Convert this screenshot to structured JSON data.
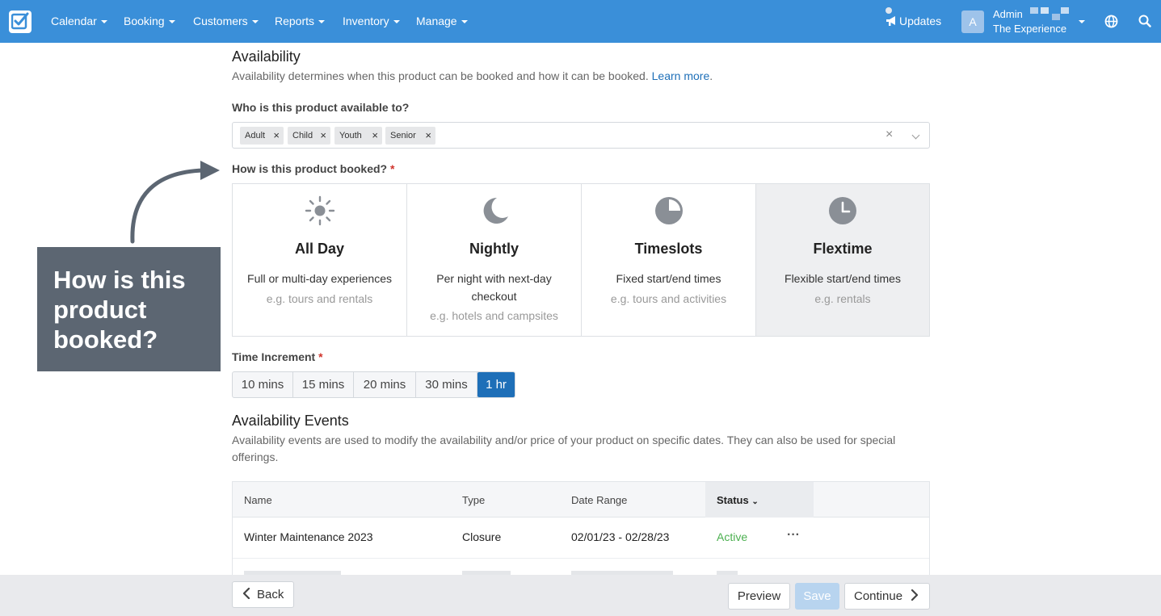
{
  "nav": {
    "items": [
      "Calendar",
      "Booking",
      "Customers",
      "Reports",
      "Inventory",
      "Manage"
    ],
    "updates": "Updates",
    "avatar_letter": "A",
    "admin_name": "Admin",
    "company": "The Experience"
  },
  "availability": {
    "title": "Availability",
    "description": "Availability determines when this product can be booked and how it can be booked.",
    "learn_more": "Learn more",
    "learn_more_suffix": "."
  },
  "who": {
    "label": "Who is this product available to?",
    "tags": [
      "Adult",
      "Child",
      "Youth",
      "Senior"
    ]
  },
  "how": {
    "label": "How is this product booked?",
    "required_mark": "*",
    "options": [
      {
        "title": "All Day",
        "desc": "Full or multi-day experiences",
        "example": "e.g. tours and rentals",
        "icon": "sun-icon",
        "selected": false
      },
      {
        "title": "Nightly",
        "desc": "Per night with next-day checkout",
        "example": "e.g. hotels and campsites",
        "icon": "moon-icon",
        "selected": false
      },
      {
        "title": "Timeslots",
        "desc": "Fixed start/end times",
        "example": "e.g. tours and activities",
        "icon": "pie-clock-icon",
        "selected": false
      },
      {
        "title": "Flextime",
        "desc": "Flexible start/end times",
        "example": "e.g. rentals",
        "icon": "clock-icon",
        "selected": true
      }
    ]
  },
  "callout": {
    "text": "How is this product booked?"
  },
  "increment": {
    "label": "Time Increment",
    "required_mark": "*",
    "options": [
      "10 mins",
      "15 mins",
      "20 mins",
      "30 mins",
      "1 hr"
    ],
    "selected": "1 hr"
  },
  "events": {
    "title": "Availability Events",
    "description": "Availability events are used to modify the availability and/or price of your product on specific dates. They can also be used for special offerings.",
    "columns": [
      "Name",
      "Type",
      "Date Range",
      "Status"
    ],
    "rows": [
      {
        "name": "Winter Maintenance 2023",
        "type": "Closure",
        "date_range": "02/01/23 - 02/28/23",
        "status": "Active",
        "more": "···"
      }
    ]
  },
  "footer": {
    "back": "Back",
    "preview": "Preview",
    "save": "Save",
    "continue": "Continue"
  },
  "colors": {
    "navbar": "#3a8fd9",
    "accent": "#1e6fb8",
    "active_status": "#4cb050",
    "callout": "#5c6672"
  }
}
